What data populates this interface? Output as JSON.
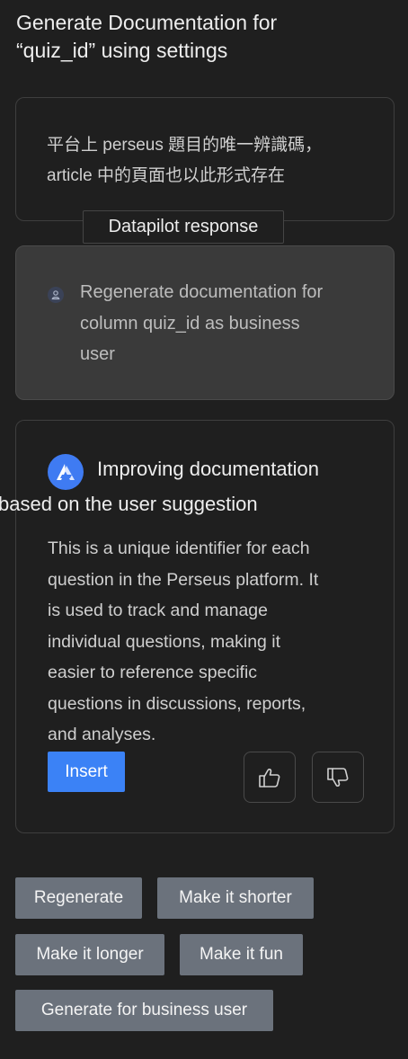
{
  "header": {
    "title_line1": "Generate Documentation for",
    "title_line2": "“quiz_id” using settings"
  },
  "current_description": {
    "line1": "平台上 perseus 題目的唯一辨識碼，",
    "line2": "article 中的頁面也以此形式存在"
  },
  "tooltip": {
    "text": "Datapilot response"
  },
  "user_request": {
    "icon": "user-icon",
    "line1": "Regenerate documentation for",
    "line2": "column quiz_id as business",
    "line3": "user"
  },
  "response": {
    "icon": "datapilot-logo-icon",
    "heading_line1": "Improving documentation",
    "heading_line2": "based on the user suggestion",
    "body_lines": [
      "This is a unique identifier for each",
      "question in the Perseus platform. It",
      "is used to track and manage",
      "individual questions, making it",
      "easier to reference specific",
      "questions in discussions, reports,",
      "and analyses."
    ],
    "insert_label": "Insert",
    "thumbs_up_icon": "thumbs-up-icon",
    "thumbs_down_icon": "thumbs-down-icon"
  },
  "suggestions": {
    "regenerate": "Regenerate",
    "shorter": "Make it shorter",
    "longer": "Make it longer",
    "fun": "Make it fun",
    "business": "Generate for business user"
  },
  "colors": {
    "background": "#1f1f1f",
    "accent": "#3b82f6",
    "chip": "#6b727c",
    "request_card": "#3a3a3a"
  }
}
